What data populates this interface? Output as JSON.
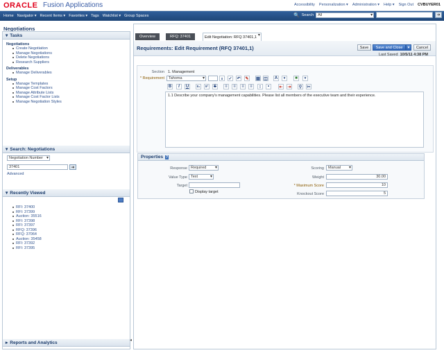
{
  "header": {
    "logo": "ORACLE",
    "product": "Fusion Applications",
    "links": [
      "Accessibility",
      "Personalization ▾",
      "Administration ▾",
      "Help ▾",
      "Sign Out"
    ],
    "user": "CVBUYER01"
  },
  "nav": {
    "items": [
      "Home",
      "Navigator ▾",
      "Recent Items ▾",
      "Favorites ▾",
      "Tags",
      "Watchlist ▾",
      "Group Spaces"
    ],
    "search_label": "Search",
    "search_scope": "All"
  },
  "left": {
    "page_title": "Negotiations",
    "tasks_title": "Tasks",
    "groups": [
      {
        "title": "Negotiations",
        "items": [
          "Create Negotiation",
          "Manage Negotiations",
          "Delete Negotiations",
          "Research Suppliers"
        ]
      },
      {
        "title": "Deliverables",
        "items": [
          "Manage Deliverables"
        ]
      },
      {
        "title": "Setup",
        "items": [
          "Manage Templates",
          "Manage Cost Factors",
          "Manage Attribute Lists",
          "Manage Cost Factor Lists",
          "Manage Negotiation Styles"
        ]
      }
    ],
    "search_title": "Search: Negotiations",
    "search_field": "Negotiation Number",
    "search_value": "37401",
    "advanced": "Advanced",
    "recent_title": "Recently Viewed",
    "recent": [
      "RFI: 37400",
      "RFI: 37399",
      "Auction: 35516",
      "RFI: 37398",
      "RFI: 37397",
      "RFQ: 37396",
      "RFQ: 37064",
      "Auction: 35458",
      "RFI: 37392",
      "RFI: 37395"
    ],
    "reports_title": "Reports and Analytics"
  },
  "tabs": [
    "Overview",
    "RFQ: 37401",
    "Edit Negotiation: RFQ 37401,1"
  ],
  "edit": {
    "title": "Requirements: Edit Requirement (RFQ 37401,1)",
    "save": "Save",
    "save_close": "Save and Close",
    "cancel": "Cancel",
    "last_saved_label": "Last Saved",
    "last_saved": "10/5/11 4:38 PM",
    "section_label": "Section",
    "section_value": "1. Management",
    "requirement_label": "* Requirement",
    "font": "Tahoma",
    "requirement_text": "1.1 Describe your company's management capabilities. Please list all members of the executive team and their experience."
  },
  "properties": {
    "title": "Properties",
    "response_label": "Response",
    "response_value": "Required",
    "value_type_label": "Value Type",
    "value_type_value": "Text",
    "target_label": "Target",
    "target_value": "",
    "display_target": "Display target",
    "scoring_label": "Scoring",
    "scoring_value": "Manual",
    "weight_label": "Weight",
    "weight_value": "30.00",
    "max_score_label": "* Maximum Score",
    "max_score_value": "10",
    "knockout_label": "Knockout Score",
    "knockout_value": "5"
  }
}
